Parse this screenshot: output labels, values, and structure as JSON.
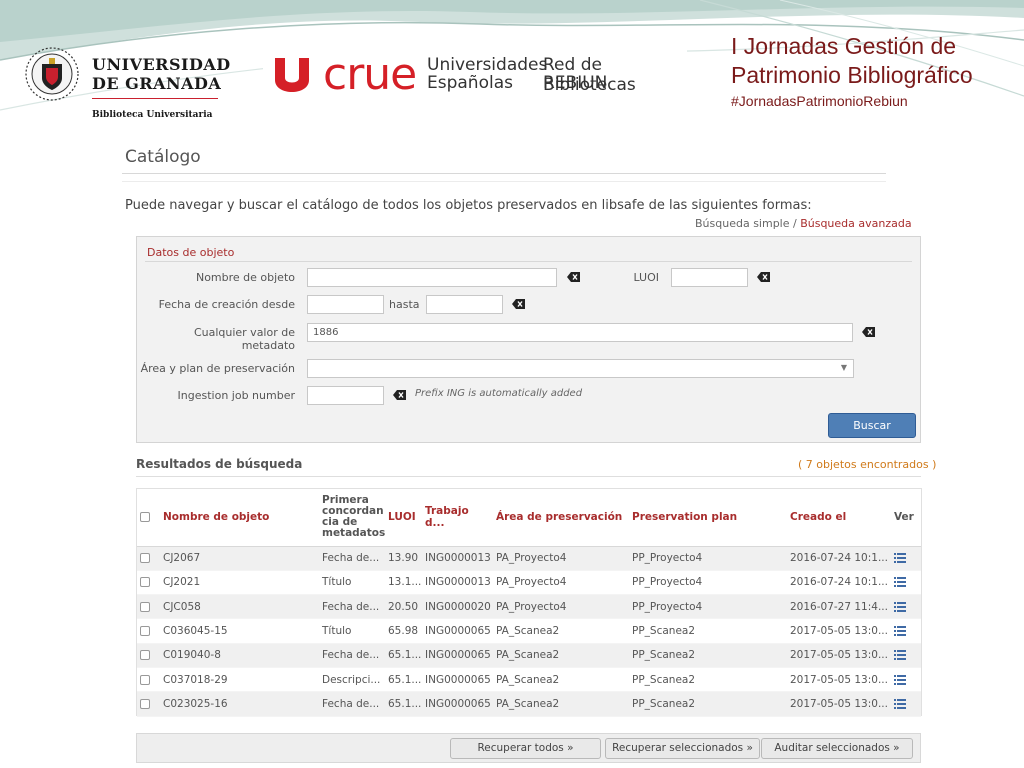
{
  "header": {
    "ugr_line1": "UNIVERSIDAD",
    "ugr_line2": "DE GRANADA",
    "ugr_subtitle": "Biblioteca Universitaria",
    "crue_word": "crue",
    "crue_line1": "Universidades",
    "crue_line2": "Españolas",
    "rebiun_line1": "Red de Bibliotecas",
    "rebiun_line2": "REBIUN",
    "slide_title_line1": "I Jornadas Gestión de",
    "slide_title_line2": "Patrimonio Bibliográfico",
    "slide_hashtag": "#JornadasPatrimonioRebiun"
  },
  "catalog": {
    "title": "Catálogo",
    "intro": "Puede navegar y buscar el catálogo de todos los objetos preservados en libsafe de las siguientes formas:",
    "simple_search": "Búsqueda simple",
    "separator": " / ",
    "advanced_search": "Búsqueda avanzada"
  },
  "form": {
    "legend": "Datos de objeto",
    "nombre_label": "Nombre de objeto",
    "nombre_value": "",
    "luoi_label": "LUOI",
    "luoi_value": "",
    "fecha_label": "Fecha de creación desde",
    "fecha_desde_value": "",
    "hasta_label": "hasta",
    "fecha_hasta_value": "",
    "metadato_label": "Cualquier valor de metadato",
    "metadato_value": "1886",
    "area_label": "Área y plan de preservación",
    "area_value": "",
    "ingestion_label": "Ingestion job number",
    "ingestion_value": "",
    "ingestion_hint": "Prefix ING is automatically added",
    "buscar_label": "Buscar"
  },
  "results": {
    "title": "Resultados de búsqueda",
    "count": "( 7 objetos encontrados )",
    "columns": {
      "nombre": "Nombre de objeto",
      "primera_1": "Primera",
      "primera_2": "concordan",
      "primera_3": "cia de",
      "primera_4": "metadatos",
      "luoi": "LUOI",
      "trabajo": "Trabajo d...",
      "area": "Área de preservación",
      "plan": "Preservation plan",
      "creado": "Creado el",
      "ver": "Ver"
    },
    "rows": [
      {
        "nombre": "CJ2067",
        "primera": "Fecha de...",
        "luoi": "13.90",
        "trabajo": "ING0000013",
        "area": "PA_Proyecto4",
        "plan": "PP_Proyecto4",
        "creado": "2016-07-24 10:1..."
      },
      {
        "nombre": "CJ2021",
        "primera": "Título",
        "luoi": "13.1...",
        "trabajo": "ING0000013",
        "area": "PA_Proyecto4",
        "plan": "PP_Proyecto4",
        "creado": "2016-07-24 10:1..."
      },
      {
        "nombre": "CJC058",
        "primera": "Fecha de...",
        "luoi": "20.50",
        "trabajo": "ING0000020",
        "area": "PA_Proyecto4",
        "plan": "PP_Proyecto4",
        "creado": "2016-07-27 11:4..."
      },
      {
        "nombre": "C036045-15",
        "primera": "Título",
        "luoi": "65.98",
        "trabajo": "ING0000065",
        "area": "PA_Scanea2",
        "plan": "PP_Scanea2",
        "creado": "2017-05-05 13:0..."
      },
      {
        "nombre": "C019040-8",
        "primera": "Fecha de...",
        "luoi": "65.1...",
        "trabajo": "ING0000065",
        "area": "PA_Scanea2",
        "plan": "PP_Scanea2",
        "creado": "2017-05-05 13:0..."
      },
      {
        "nombre": "C037018-29",
        "primera": "Descripci...",
        "luoi": "65.1...",
        "trabajo": "ING0000065",
        "area": "PA_Scanea2",
        "plan": "PP_Scanea2",
        "creado": "2017-05-05 13:0..."
      },
      {
        "nombre": "C023025-16",
        "primera": "Fecha de...",
        "luoi": "65.1...",
        "trabajo": "ING0000065",
        "area": "PA_Scanea2",
        "plan": "PP_Scanea2",
        "creado": "2017-05-05 13:0..."
      }
    ]
  },
  "footer": {
    "recuperar_todos": "Recuperar todos »",
    "recuperar_seleccionados": "Recuperar seleccionados »",
    "auditar_seleccionados": "Auditar seleccionados »"
  },
  "icons": {
    "clear": "clear-field-icon",
    "view": "list-view-icon",
    "seal": "university-seal-icon",
    "crue_logo": "crue-logo-icon"
  },
  "colors": {
    "accent_red": "#a82d2d",
    "brand_red": "#d52027",
    "button_blue": "#4f7fb6",
    "count_orange": "#d07a1a",
    "title_maroon": "#7a1a1a"
  }
}
